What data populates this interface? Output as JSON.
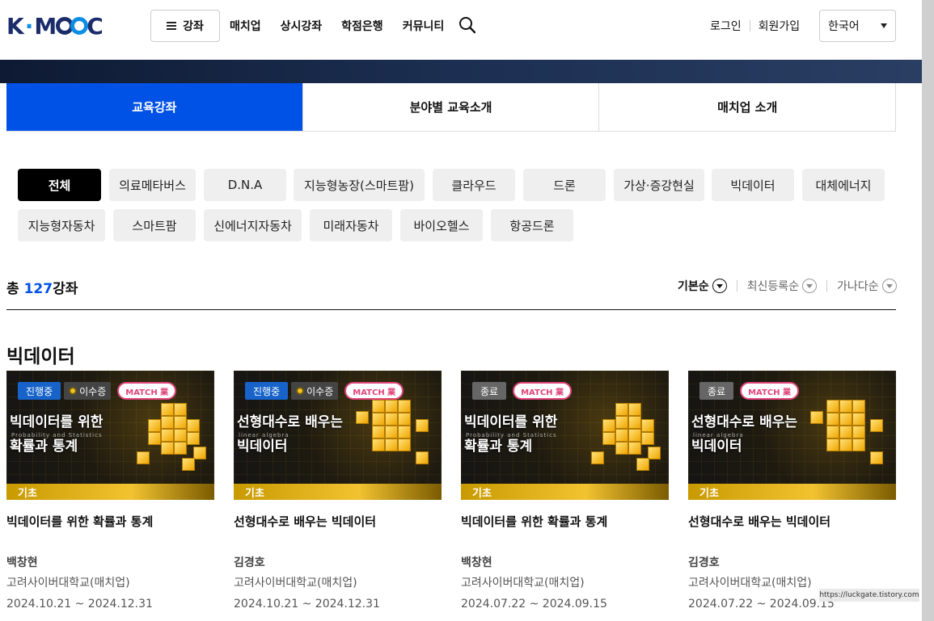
{
  "header": {
    "logo": {
      "k": "K",
      "dash": "·",
      "m": "M",
      "c": "C"
    },
    "menu_button": "강좌",
    "nav": [
      "매치업",
      "상시강좌",
      "학점은행",
      "커뮤니티"
    ],
    "login": "로그인",
    "signup": "회원가입",
    "language": "한국어"
  },
  "tabs": [
    {
      "label": "교육강좌",
      "active": true
    },
    {
      "label": "분야별 교육소개",
      "active": false
    },
    {
      "label": "매치업 소개",
      "active": false
    }
  ],
  "filters": [
    {
      "label": "전체",
      "active": true
    },
    {
      "label": "의료메타버스"
    },
    {
      "label": "D.N.A"
    },
    {
      "label": "지능형농장(스마트팜)"
    },
    {
      "label": "클라우드"
    },
    {
      "label": "드론"
    },
    {
      "label": "가상·증강현실"
    },
    {
      "label": "빅데이터"
    },
    {
      "label": "대체에너지"
    },
    {
      "label": "지능형자동차"
    },
    {
      "label": "스마트팜"
    },
    {
      "label": "신에너지자동차"
    },
    {
      "label": "미래자동차"
    },
    {
      "label": "바이오헬스"
    },
    {
      "label": "항공드론"
    }
  ],
  "summary": {
    "prefix": "총 ",
    "count": "127",
    "suffix": "강좌"
  },
  "sort": [
    {
      "label": "기본순",
      "active": true
    },
    {
      "label": "최신등록순"
    },
    {
      "label": "가나다순"
    }
  ],
  "section_title": "빅데이터",
  "cards": [
    {
      "status": "진행중",
      "status_type": "live",
      "cert": "이수증",
      "match": "MATCH 業",
      "thumb_title_1": "빅데이터를 위한",
      "thumb_sub": "Probability and Statistics",
      "thumb_title_2": "확률과 통계",
      "level": "기초",
      "title": "빅데이터를 위한 확률과 통계",
      "professor": "백창현",
      "university": "고려사이버대학교(매치업)",
      "dates": "2024.10.21 ~ 2024.12.31"
    },
    {
      "status": "진행중",
      "status_type": "live",
      "cert": "이수증",
      "match": "MATCH 業",
      "thumb_title_1": "선형대수로 배우는",
      "thumb_sub": "linear algebra",
      "thumb_title_2": "빅데이터",
      "level": "기초",
      "title": "선형대수로 배우는 빅데이터",
      "professor": "김경호",
      "university": "고려사이버대학교(매치업)",
      "dates": "2024.10.21 ~ 2024.12.31"
    },
    {
      "status": "종료",
      "status_type": "end",
      "cert": "",
      "match": "MATCH 業",
      "thumb_title_1": "빅데이터를 위한",
      "thumb_sub": "Probability and Statistics",
      "thumb_title_2": "확률과 통계",
      "level": "기초",
      "title": "빅데이터를 위한 확률과 통계",
      "professor": "백창현",
      "university": "고려사이버대학교(매치업)",
      "dates": "2024.07.22 ~ 2024.09.15"
    },
    {
      "status": "종료",
      "status_type": "end",
      "cert": "",
      "match": "MATCH 業",
      "thumb_title_1": "선형대수로 배우는",
      "thumb_sub": "linear algebra",
      "thumb_title_2": "빅데이터",
      "level": "기초",
      "title": "선형대수로 배우는 빅데이터",
      "professor": "김경호",
      "university": "고려사이버대학교(매치업)",
      "dates": "2024.07.22 ~ 2024.09.15"
    }
  ],
  "watermark": "https://luckgate.tistory.com",
  "colors": {
    "accent": "#0051e6",
    "brand_navy": "#1b2c6b",
    "match_pink": "#e0457b",
    "level_gold": "#f2c230"
  }
}
